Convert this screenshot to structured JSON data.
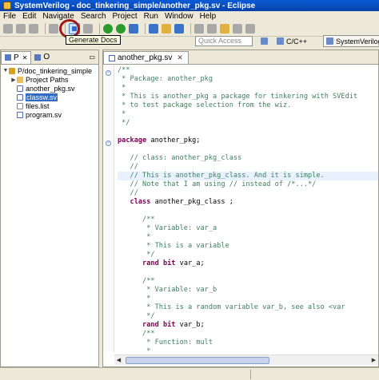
{
  "window": {
    "title": "SystemVerilog - doc_tinkering_simple/another_pkg.sv - Eclipse"
  },
  "menu": [
    "File",
    "Edit",
    "Navigate",
    "Search",
    "Project",
    "Run",
    "Window",
    "Help"
  ],
  "toolbar": {
    "tooltip": "Generate Docs"
  },
  "quick_access": {
    "placeholder": "Quick Access"
  },
  "perspectives": {
    "cpp": "C/C++",
    "sv": "SystemVerilog"
  },
  "left_panel": {
    "tabs": [
      "P",
      "O"
    ],
    "tree": [
      {
        "label": "P/doc_tinkering_simple",
        "icon": "project-icon",
        "expanded": true
      },
      {
        "label": "Project Paths",
        "icon": "folder-icon"
      },
      {
        "label": "another_pkg.sv",
        "icon": "sv-file-icon"
      },
      {
        "label": "classw.sv",
        "icon": "sv-file-icon",
        "selected": true
      },
      {
        "label": "files.list",
        "icon": "file-icon"
      },
      {
        "label": "program.sv",
        "icon": "sv-file-icon"
      }
    ]
  },
  "editor": {
    "tab": "another_pkg.sv",
    "lines": [
      "/**",
      " * Package: another_pkg",
      " *",
      " * This is another_pkg a package for tinkering with SVEdit",
      " * to test package selection from the wiz.",
      " *",
      " */",
      "",
      "package another_pkg;",
      "",
      "   // class: another_pkg_class",
      "   //",
      "   // This is another_pkg_class. And it is simple.",
      "   // Note that I am using // instead of /*...*/",
      "   //",
      "   class another_pkg_class ;",
      "",
      "      /**",
      "       * Variable: var_a",
      "       *",
      "       * This is a variable",
      "       */",
      "      rand bit var_a;",
      "",
      "      /**",
      "       * Variable: var_b",
      "       *",
      "       * This is a random variable var_b, see also <var",
      "       */",
      "      rand bit var_b;",
      "      /**",
      "       * Function: mult",
      "       *"
    ]
  }
}
